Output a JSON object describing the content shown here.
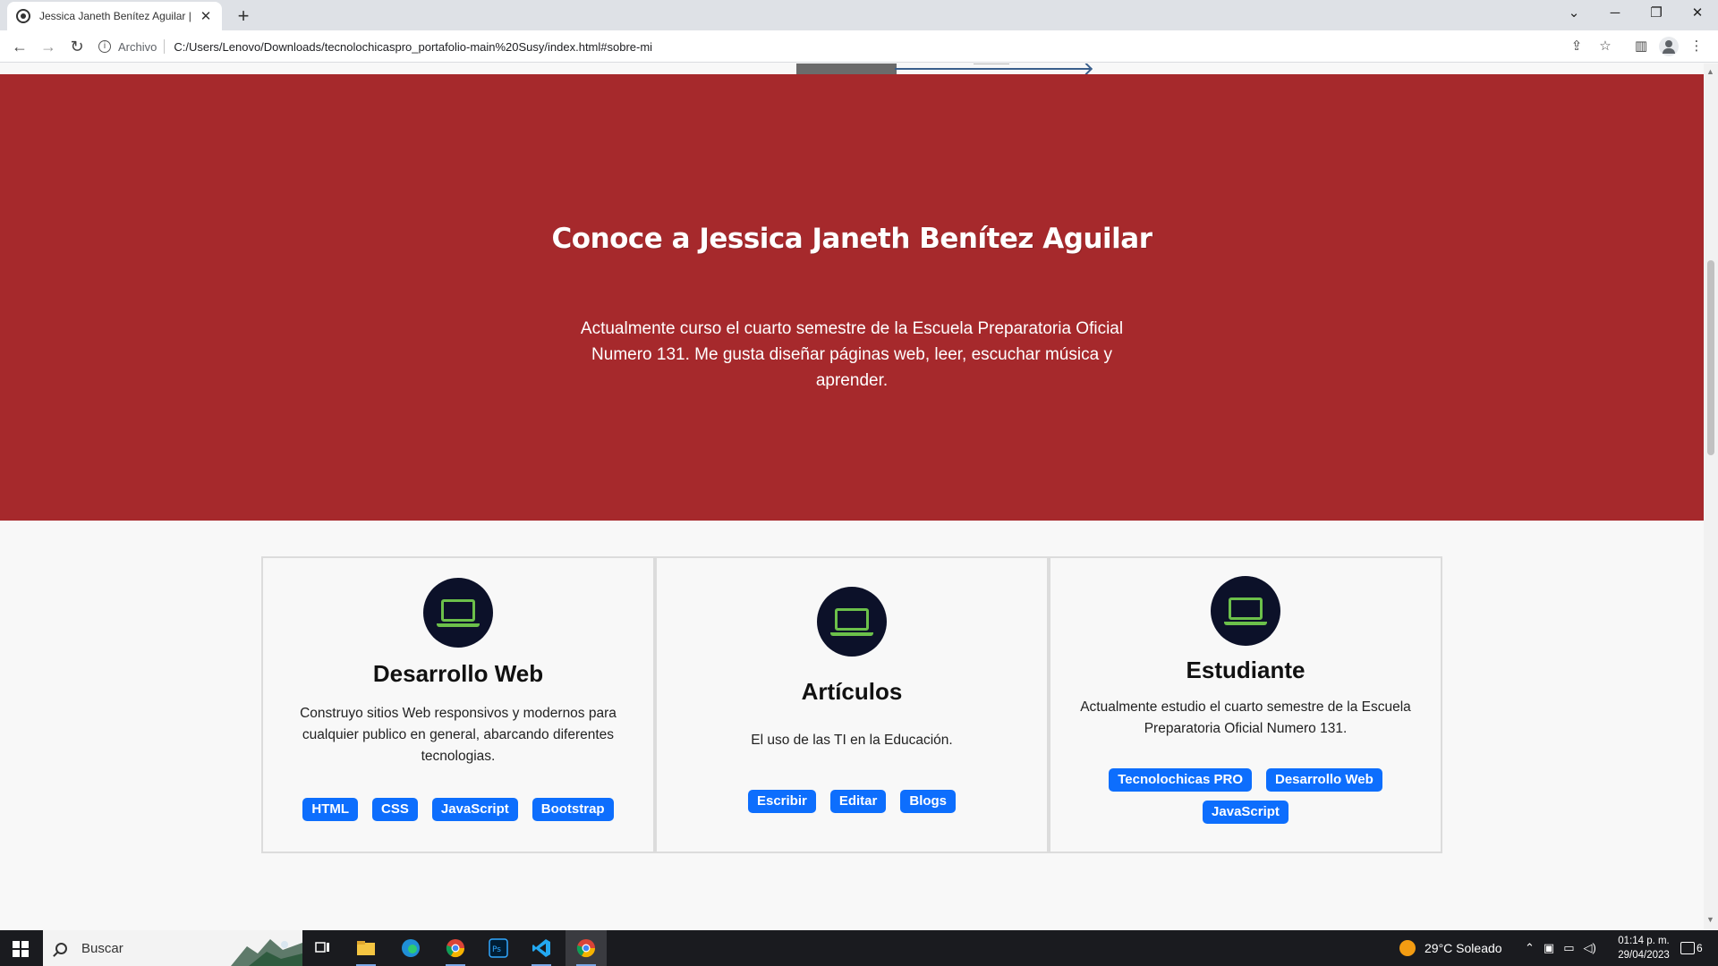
{
  "browser": {
    "tab_title": "Jessica Janeth Benítez Aguilar | D",
    "new_tab": "+",
    "scheme_label": "Archivo",
    "url": "C:/Users/Lenovo/Downloads/tecnolochicaspro_portafolio-main%20Susy/index.html#sobre-mi"
  },
  "hero": {
    "title": "Conoce a Jessica Janeth Benítez Aguilar",
    "text": "Actualmente curso el cuarto semestre de la Escuela Preparatoria Oficial Numero 131. Me gusta diseñar páginas web, leer, escuchar música y aprender."
  },
  "cards": [
    {
      "title": "Desarrollo Web",
      "text": "Construyo sitios Web responsivos y modernos para cualquier publico en general, abarcando diferentes tecnologias.",
      "badges": [
        "HTML",
        "CSS",
        "JavaScript",
        "Bootstrap"
      ]
    },
    {
      "title": "Artículos",
      "text": "El uso de las TI en la Educación.",
      "badges": [
        "Escribir",
        "Editar",
        "Blogs"
      ]
    },
    {
      "title": "Estudiante",
      "text": "Actualmente estudio el cuarto semestre de la Escuela Preparatoria Oficial Numero 131.",
      "badges": [
        "Tecnolochicas PRO",
        "Desarrollo Web",
        "JavaScript"
      ]
    }
  ],
  "taskbar": {
    "search_placeholder": "Buscar",
    "weather": "29°C  Soleado",
    "time": "01:14 p. m.",
    "date": "29/04/2023",
    "notifications": "6"
  },
  "colors": {
    "hero_bg": "#a6292c",
    "icon_bg": "#0c1129",
    "icon_fg": "#6cc04a",
    "badge_bg": "#0d6efd"
  },
  "icons": {
    "card_icon": "laptop-icon"
  }
}
